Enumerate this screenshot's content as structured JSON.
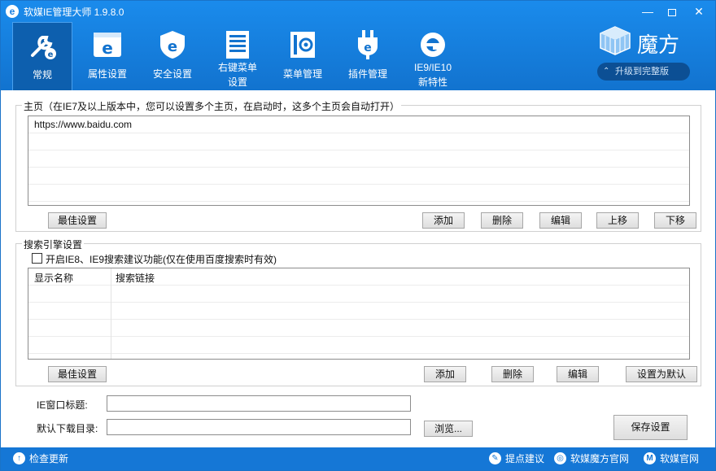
{
  "window": {
    "title": "软媒IE管理大师 1.9.8.0",
    "logo_glyph": "e",
    "accent_color": "#1a8bec"
  },
  "toolbar": {
    "items": [
      {
        "label": "常规",
        "icon": "wrench-ie-icon",
        "active": true
      },
      {
        "label": "属性设置",
        "icon": "ie-window-icon"
      },
      {
        "label": "安全设置",
        "icon": "ie-shield-icon"
      },
      {
        "label": "右键菜单设置",
        "line1": "右键菜单",
        "line2": "设置",
        "icon": "context-menu-icon"
      },
      {
        "label": "菜单管理",
        "icon": "menu-gear-icon"
      },
      {
        "label": "插件管理",
        "icon": "plugin-icon"
      },
      {
        "label": "IE9/IE10新特性",
        "line1": "IE9/IE10",
        "line2": "新特性",
        "icon": "ie9-logo-icon"
      }
    ]
  },
  "brand": {
    "name": "魔方",
    "upgrade_text": "升级到完整版"
  },
  "homepage": {
    "group_title": "主页（在IE7及以上版本中，您可以设置多个主页，在启动时，这多个主页会自动打开）",
    "entries": [
      "https://www.baidu.com"
    ],
    "buttons": {
      "best": "最佳设置",
      "add": "添加",
      "delete": "删除",
      "edit": "编辑",
      "up": "上移",
      "down": "下移"
    }
  },
  "search": {
    "group_title": "搜索引擎设置",
    "checkbox_label": "开启IE8、IE9搜索建议功能(仅在使用百度搜索时有效)",
    "checkbox_checked": false,
    "columns": [
      "显示名称",
      "搜索链接"
    ],
    "rows": [],
    "buttons": {
      "best": "最佳设置",
      "add": "添加",
      "delete": "删除",
      "edit": "编辑",
      "default": "设置为默认"
    }
  },
  "fields": {
    "ie_title_label": "IE窗口标题:",
    "ie_title_value": "",
    "download_dir_label": "默认下载目录:",
    "download_dir_value": "",
    "browse": "浏览...",
    "save": "保存设置"
  },
  "status": {
    "check_update": "检查更新",
    "suggest": "提点建议",
    "ruanmei_cube_site": "软媒魔方官网",
    "ruanmei_site": "软媒官网"
  }
}
